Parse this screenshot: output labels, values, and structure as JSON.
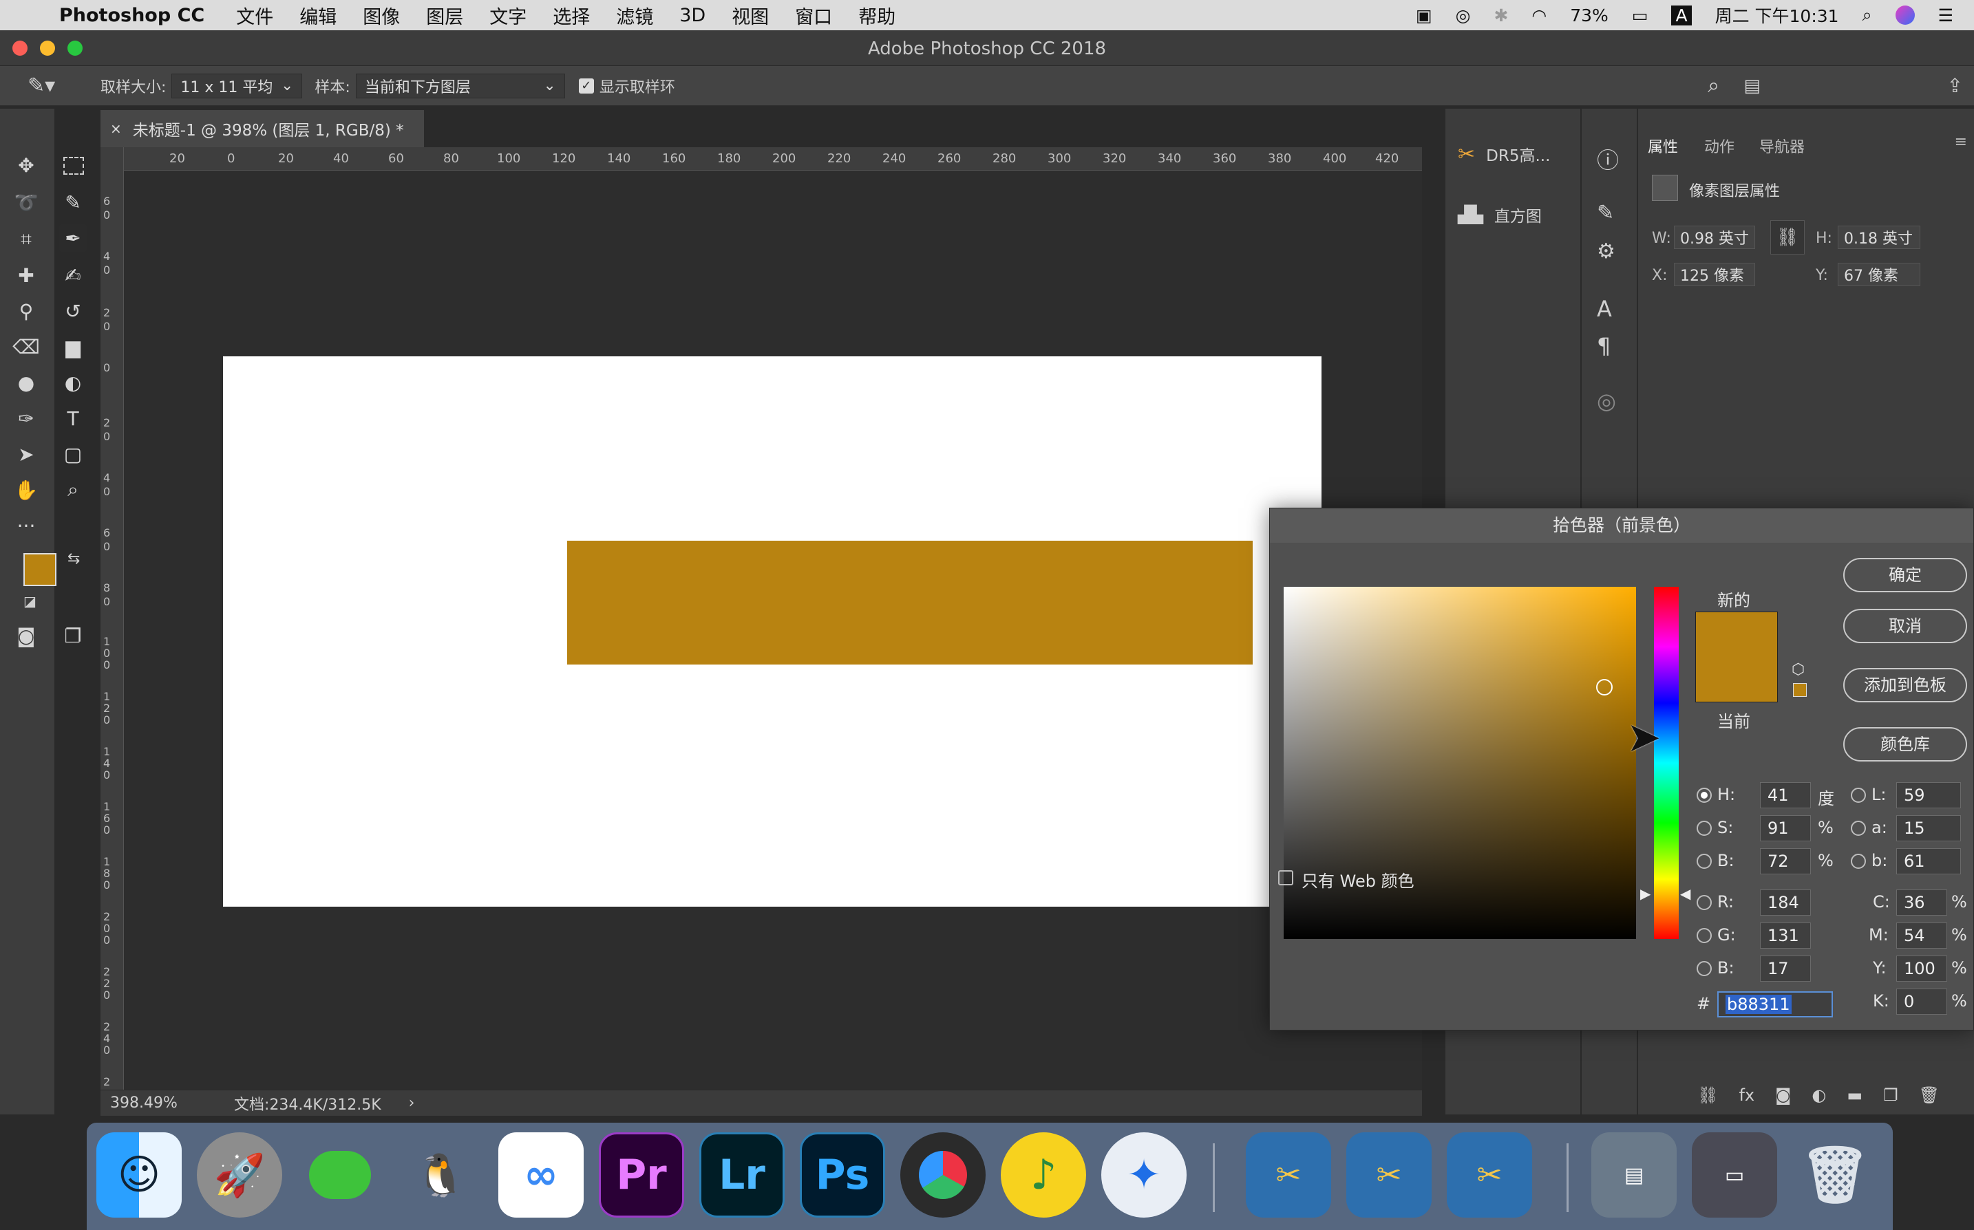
{
  "menubar": {
    "app_name": "Photoshop CC",
    "items": [
      "文件",
      "编辑",
      "图像",
      "图层",
      "文字",
      "选择",
      "滤镜",
      "3D",
      "视图",
      "窗口",
      "帮助"
    ],
    "battery": "73%",
    "input_method": "A",
    "clock": "周二 下午10:31"
  },
  "window": {
    "title": "Adobe Photoshop CC 2018"
  },
  "options": {
    "sample_size_label": "取样大小:",
    "sample_size_value": "11 x 11 平均",
    "sample_label": "样本:",
    "sample_value": "当前和下方图层",
    "show_ring_label": "显示取样环"
  },
  "document": {
    "tab_title": "未标题-1 @ 398% (图层 1, RGB/8) *",
    "ruler_top": [
      "20",
      "0",
      "20",
      "40",
      "60",
      "80",
      "100",
      "120",
      "140",
      "160",
      "180",
      "200",
      "220",
      "240",
      "260",
      "280",
      "300",
      "320",
      "340",
      "360",
      "380",
      "400",
      "420"
    ],
    "ruler_left": [
      "6",
      "0",
      "4",
      "0",
      "2",
      "0",
      "0",
      "2",
      "0",
      "4",
      "0",
      "6",
      "0",
      "8",
      "0",
      "1 0 0",
      "1 2 0",
      "1 4 0",
      "1 6 0",
      "1 8 0",
      "2 0 0",
      "2 2 0",
      "2 4 0",
      "2"
    ],
    "zoom": "398.49%",
    "doc_info": "文档:234.4K/312.5K",
    "fill_color": "#b88311"
  },
  "panels": {
    "col1": [
      "DR5高...",
      "直方图"
    ],
    "props_tabs": [
      "属性",
      "动作",
      "导航器"
    ],
    "props_title": "像素图层属性",
    "w_label": "W:",
    "w_value": "0.98 英寸",
    "h_label": "H:",
    "h_value": "0.18 英寸",
    "x_label": "X:",
    "x_value": "125 像素",
    "y_label": "Y:",
    "y_value": "67 像素"
  },
  "picker": {
    "title": "拾色器（前景色）",
    "ok": "确定",
    "cancel": "取消",
    "add_swatch": "添加到色板",
    "color_libs": "颜色库",
    "new_label": "新的",
    "current_label": "当前",
    "web_only": "只有 Web 颜色",
    "h_label": "H:",
    "h": "41",
    "h_unit": "度",
    "s_label": "S:",
    "s": "91",
    "s_unit": "%",
    "b_label": "B:",
    "b": "72",
    "b_unit": "%",
    "r_label": "R:",
    "r": "184",
    "g_label": "G:",
    "g": "131",
    "bb_label": "B:",
    "bb": "17",
    "l_label": "L:",
    "l": "59",
    "a_label": "a:",
    "a": "15",
    "lb_label": "b:",
    "lb": "61",
    "c_label": "C:",
    "c": "36",
    "m_label": "M:",
    "m": "54",
    "y_label": "Y:",
    "y": "100",
    "k_label": "K:",
    "k": "0",
    "pct": "%",
    "hash": "#",
    "hex": "b88311",
    "new_color": "#b88311",
    "current_color": "#b88311"
  },
  "dock": {
    "apps": [
      "finder",
      "launchpad",
      "wechat",
      "qq",
      "baidu-netdisk",
      "Pr",
      "Lr",
      "Ps",
      "davinci-resolve",
      "music",
      "safari",
      "clips-1",
      "clips-2",
      "clips-3",
      "downloads",
      "stack",
      "trash"
    ]
  }
}
